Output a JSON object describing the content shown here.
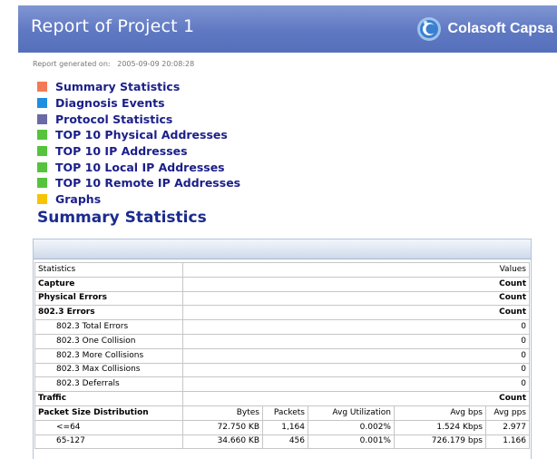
{
  "header": {
    "title": "Report of Project 1",
    "brand_name": "Colasoft Capsa",
    "brand_icon": "colasoft-logo-icon",
    "background_color": "#5f78c2"
  },
  "generated": {
    "label": "Report generated on:",
    "datetime": "2005-09-09 20:08:28"
  },
  "toc": [
    {
      "label": "Summary Statistics",
      "color": "#f47a56"
    },
    {
      "label": "Diagnosis Events",
      "color": "#1e8ee0"
    },
    {
      "label": "Protocol Statistics",
      "color": "#6a6aa6"
    },
    {
      "label": "TOP 10 Physical Addresses",
      "color": "#55c33c"
    },
    {
      "label": "TOP 10 IP Addresses",
      "color": "#55c33c"
    },
    {
      "label": "TOP 10 Local IP Addresses",
      "color": "#55c33c"
    },
    {
      "label": "TOP 10 Remote IP Addresses",
      "color": "#55c33c"
    },
    {
      "label": "Graphs",
      "color": "#f6c400"
    }
  ],
  "section_title": "Summary Statistics",
  "stats": {
    "header": {
      "left": "Statistics",
      "right": "Values"
    },
    "capture": {
      "label": "Capture",
      "value": "Count"
    },
    "physical_errors": {
      "label": "Physical Errors",
      "value": "Count"
    },
    "errors_8023": {
      "label": "802.3 Errors",
      "value": "Count"
    },
    "error_rows": [
      {
        "label": "802.3 Total Errors",
        "value": "0"
      },
      {
        "label": "802.3 One Collision",
        "value": "0"
      },
      {
        "label": "802.3 More Collisions",
        "value": "0"
      },
      {
        "label": "802.3 Max Collisions",
        "value": "0"
      },
      {
        "label": "802.3 Deferrals",
        "value": "0"
      }
    ],
    "traffic": {
      "label": "Traffic",
      "value": "Count"
    },
    "packet_size": {
      "label": "Packet Size Distribution",
      "columns": [
        "Bytes",
        "Packets",
        "Avg Utilization",
        "Avg bps",
        "Avg pps"
      ]
    },
    "packet_rows": [
      {
        "label": "<=64",
        "bytes": "72.750 KB",
        "packets": "1,164",
        "util": "0.002%",
        "bps": "1.524 Kbps",
        "pps": "2.977"
      },
      {
        "label": "65-127",
        "bytes": "34.660 KB",
        "packets": "456",
        "util": "0.001%",
        "bps": "726.179 bps",
        "pps": "1.166"
      }
    ]
  }
}
